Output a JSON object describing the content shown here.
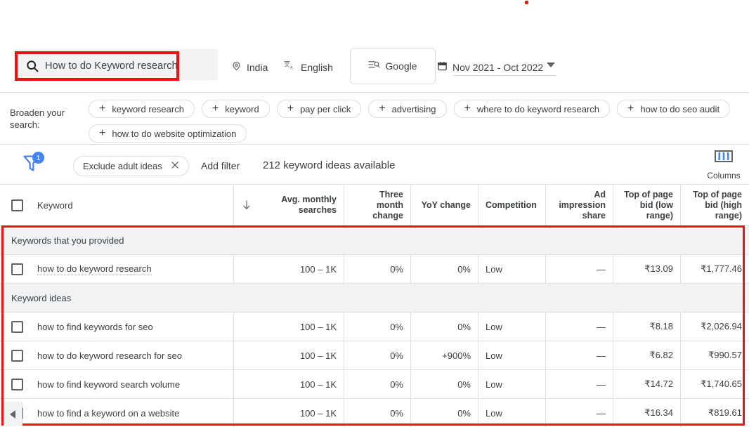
{
  "search": {
    "value": "How to do Keyword research",
    "icon": "search-icon"
  },
  "settings": {
    "location": "India",
    "language": "English",
    "network": "Google",
    "date_range": "Nov 2021 - Oct 2022"
  },
  "broaden": {
    "label": "Broaden your search:",
    "chips": [
      "keyword research",
      "keyword",
      "pay per click",
      "advertising",
      "where to do keyword research",
      "how to do seo audit",
      "how to do website optimization"
    ]
  },
  "filters": {
    "badge_count": "1",
    "exclude_chip": "Exclude adult ideas",
    "add_filter": "Add filter",
    "ideas_available": "212 keyword ideas available",
    "columns_label": "Columns"
  },
  "table": {
    "headers": {
      "keyword": "Keyword",
      "avg_monthly_searches": "Avg. monthly searches",
      "three_month_change": "Three month change",
      "yoy_change": "YoY change",
      "competition": "Competition",
      "ad_impression_share": "Ad impression share",
      "top_of_page_bid_low": "Top of page bid (low range)",
      "top_of_page_bid_high": "Top of page bid (high range)"
    },
    "groups": [
      {
        "title": "Keywords that you provided",
        "rows": [
          {
            "keyword": "how to do keyword research",
            "avg_monthly_searches": "100 – 1K",
            "three_month_change": "0%",
            "yoy_change": "0%",
            "competition": "Low",
            "ad_impression_share": "—",
            "bid_low": "₹13.09",
            "bid_high": "₹1,777.46"
          }
        ]
      },
      {
        "title": "Keyword ideas",
        "rows": [
          {
            "keyword": "how to find keywords for seo",
            "avg_monthly_searches": "100 – 1K",
            "three_month_change": "0%",
            "yoy_change": "0%",
            "competition": "Low",
            "ad_impression_share": "—",
            "bid_low": "₹8.18",
            "bid_high": "₹2,026.94"
          },
          {
            "keyword": "how to do keyword research for seo",
            "avg_monthly_searches": "100 – 1K",
            "three_month_change": "0%",
            "yoy_change": "+900%",
            "competition": "Low",
            "ad_impression_share": "—",
            "bid_low": "₹6.82",
            "bid_high": "₹990.57"
          },
          {
            "keyword": "how to find keyword search volume",
            "avg_monthly_searches": "100 – 1K",
            "three_month_change": "0%",
            "yoy_change": "0%",
            "competition": "Low",
            "ad_impression_share": "—",
            "bid_low": "₹14.72",
            "bid_high": "₹1,740.65"
          },
          {
            "keyword": "how to find a keyword on a website",
            "avg_monthly_searches": "100 – 1K",
            "three_month_change": "0%",
            "yoy_change": "0%",
            "competition": "Low",
            "ad_impression_share": "—",
            "bid_low": "₹16.34",
            "bid_high": "₹819.61"
          }
        ]
      }
    ]
  },
  "colors": {
    "highlight": "#ee1111",
    "accent_blue": "#4285f4",
    "text": "#3c4043",
    "group_bg": "#f1f3f4"
  }
}
